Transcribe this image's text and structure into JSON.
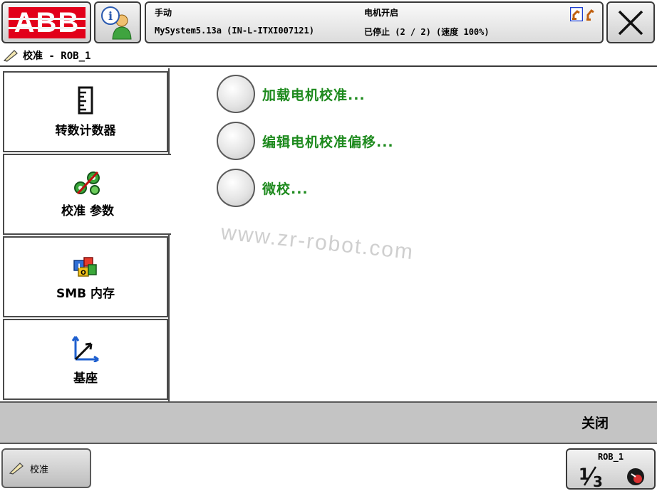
{
  "topbar": {
    "logo_text": "ABB",
    "status": {
      "mode": "手动",
      "system": "MySystem5.13a (IN-L-ITXI007121)",
      "motor_state": "电机开启",
      "run_state": "已停止 (2 / 2) (速度 100%)"
    }
  },
  "title": {
    "icon": "calibration-icon",
    "text": "校准 - ROB_1"
  },
  "sidebar": {
    "items": [
      {
        "label": "转数计数器",
        "icon": "revolution-counter-icon",
        "selected": false
      },
      {
        "label": "校准 参数",
        "icon": "calibration-parameters-icon",
        "selected": true
      },
      {
        "label": "SMB 内存",
        "icon": "smb-memory-icon",
        "selected": false
      },
      {
        "label": "基座",
        "icon": "base-frame-icon",
        "selected": false
      }
    ]
  },
  "options": [
    {
      "label": "加载电机校准..."
    },
    {
      "label": "编辑电机校准偏移..."
    },
    {
      "label": "微校..."
    }
  ],
  "watermark": "www.zr-robot.com",
  "commandbar": {
    "close_label": "关闭"
  },
  "taskbar": {
    "task_label": "校准",
    "quickset_unit": "ROB_1",
    "quickset_fraction": "1/3"
  },
  "colors": {
    "abb_red": "#e2001a",
    "option_text": "#1d8a1d",
    "command_bar": "#c4c4c4"
  }
}
